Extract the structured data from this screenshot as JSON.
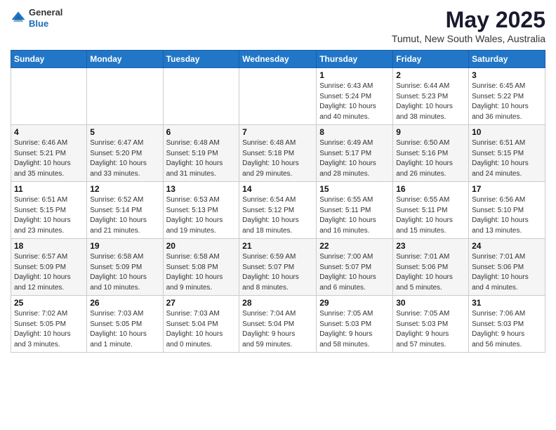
{
  "header": {
    "logo_general": "General",
    "logo_blue": "Blue",
    "title": "May 2025",
    "subtitle": "Tumut, New South Wales, Australia"
  },
  "weekdays": [
    "Sunday",
    "Monday",
    "Tuesday",
    "Wednesday",
    "Thursday",
    "Friday",
    "Saturday"
  ],
  "weeks": [
    [
      {
        "day": "",
        "info": ""
      },
      {
        "day": "",
        "info": ""
      },
      {
        "day": "",
        "info": ""
      },
      {
        "day": "",
        "info": ""
      },
      {
        "day": "1",
        "info": "Sunrise: 6:43 AM\nSunset: 5:24 PM\nDaylight: 10 hours\nand 40 minutes."
      },
      {
        "day": "2",
        "info": "Sunrise: 6:44 AM\nSunset: 5:23 PM\nDaylight: 10 hours\nand 38 minutes."
      },
      {
        "day": "3",
        "info": "Sunrise: 6:45 AM\nSunset: 5:22 PM\nDaylight: 10 hours\nand 36 minutes."
      }
    ],
    [
      {
        "day": "4",
        "info": "Sunrise: 6:46 AM\nSunset: 5:21 PM\nDaylight: 10 hours\nand 35 minutes."
      },
      {
        "day": "5",
        "info": "Sunrise: 6:47 AM\nSunset: 5:20 PM\nDaylight: 10 hours\nand 33 minutes."
      },
      {
        "day": "6",
        "info": "Sunrise: 6:48 AM\nSunset: 5:19 PM\nDaylight: 10 hours\nand 31 minutes."
      },
      {
        "day": "7",
        "info": "Sunrise: 6:48 AM\nSunset: 5:18 PM\nDaylight: 10 hours\nand 29 minutes."
      },
      {
        "day": "8",
        "info": "Sunrise: 6:49 AM\nSunset: 5:17 PM\nDaylight: 10 hours\nand 28 minutes."
      },
      {
        "day": "9",
        "info": "Sunrise: 6:50 AM\nSunset: 5:16 PM\nDaylight: 10 hours\nand 26 minutes."
      },
      {
        "day": "10",
        "info": "Sunrise: 6:51 AM\nSunset: 5:15 PM\nDaylight: 10 hours\nand 24 minutes."
      }
    ],
    [
      {
        "day": "11",
        "info": "Sunrise: 6:51 AM\nSunset: 5:15 PM\nDaylight: 10 hours\nand 23 minutes."
      },
      {
        "day": "12",
        "info": "Sunrise: 6:52 AM\nSunset: 5:14 PM\nDaylight: 10 hours\nand 21 minutes."
      },
      {
        "day": "13",
        "info": "Sunrise: 6:53 AM\nSunset: 5:13 PM\nDaylight: 10 hours\nand 19 minutes."
      },
      {
        "day": "14",
        "info": "Sunrise: 6:54 AM\nSunset: 5:12 PM\nDaylight: 10 hours\nand 18 minutes."
      },
      {
        "day": "15",
        "info": "Sunrise: 6:55 AM\nSunset: 5:11 PM\nDaylight: 10 hours\nand 16 minutes."
      },
      {
        "day": "16",
        "info": "Sunrise: 6:55 AM\nSunset: 5:11 PM\nDaylight: 10 hours\nand 15 minutes."
      },
      {
        "day": "17",
        "info": "Sunrise: 6:56 AM\nSunset: 5:10 PM\nDaylight: 10 hours\nand 13 minutes."
      }
    ],
    [
      {
        "day": "18",
        "info": "Sunrise: 6:57 AM\nSunset: 5:09 PM\nDaylight: 10 hours\nand 12 minutes."
      },
      {
        "day": "19",
        "info": "Sunrise: 6:58 AM\nSunset: 5:09 PM\nDaylight: 10 hours\nand 10 minutes."
      },
      {
        "day": "20",
        "info": "Sunrise: 6:58 AM\nSunset: 5:08 PM\nDaylight: 10 hours\nand 9 minutes."
      },
      {
        "day": "21",
        "info": "Sunrise: 6:59 AM\nSunset: 5:07 PM\nDaylight: 10 hours\nand 8 minutes."
      },
      {
        "day": "22",
        "info": "Sunrise: 7:00 AM\nSunset: 5:07 PM\nDaylight: 10 hours\nand 6 minutes."
      },
      {
        "day": "23",
        "info": "Sunrise: 7:01 AM\nSunset: 5:06 PM\nDaylight: 10 hours\nand 5 minutes."
      },
      {
        "day": "24",
        "info": "Sunrise: 7:01 AM\nSunset: 5:06 PM\nDaylight: 10 hours\nand 4 minutes."
      }
    ],
    [
      {
        "day": "25",
        "info": "Sunrise: 7:02 AM\nSunset: 5:05 PM\nDaylight: 10 hours\nand 3 minutes."
      },
      {
        "day": "26",
        "info": "Sunrise: 7:03 AM\nSunset: 5:05 PM\nDaylight: 10 hours\nand 1 minute."
      },
      {
        "day": "27",
        "info": "Sunrise: 7:03 AM\nSunset: 5:04 PM\nDaylight: 10 hours\nand 0 minutes."
      },
      {
        "day": "28",
        "info": "Sunrise: 7:04 AM\nSunset: 5:04 PM\nDaylight: 9 hours\nand 59 minutes."
      },
      {
        "day": "29",
        "info": "Sunrise: 7:05 AM\nSunset: 5:03 PM\nDaylight: 9 hours\nand 58 minutes."
      },
      {
        "day": "30",
        "info": "Sunrise: 7:05 AM\nSunset: 5:03 PM\nDaylight: 9 hours\nand 57 minutes."
      },
      {
        "day": "31",
        "info": "Sunrise: 7:06 AM\nSunset: 5:03 PM\nDaylight: 9 hours\nand 56 minutes."
      }
    ]
  ]
}
